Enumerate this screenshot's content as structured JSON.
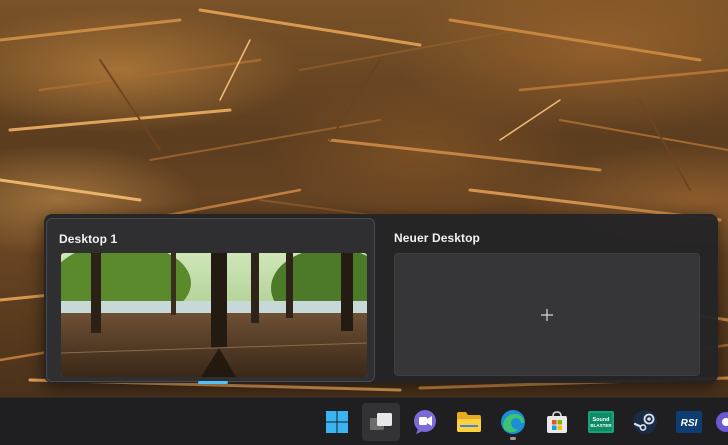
{
  "taskview": {
    "desktops": [
      {
        "title": "Desktop 1",
        "active": true
      },
      {
        "title": "Neuer Desktop",
        "is_new": true
      }
    ],
    "new_desktop_icon": "plus-icon",
    "accent_color": "#4cc2ff"
  },
  "taskbar": {
    "icons": [
      {
        "name": "windows-start-icon"
      },
      {
        "name": "task-view-icon",
        "selected": true
      },
      {
        "name": "teams-chat-icon"
      },
      {
        "name": "file-explorer-icon"
      },
      {
        "name": "edge-browser-icon",
        "running": true
      },
      {
        "name": "microsoft-store-icon"
      },
      {
        "name": "sound-blaster-icon",
        "text": "Sound BLASTER"
      },
      {
        "name": "steam-icon"
      },
      {
        "name": "rsi-launcher-icon",
        "text": "RSI"
      },
      {
        "name": "overflow-app-icon"
      }
    ]
  }
}
